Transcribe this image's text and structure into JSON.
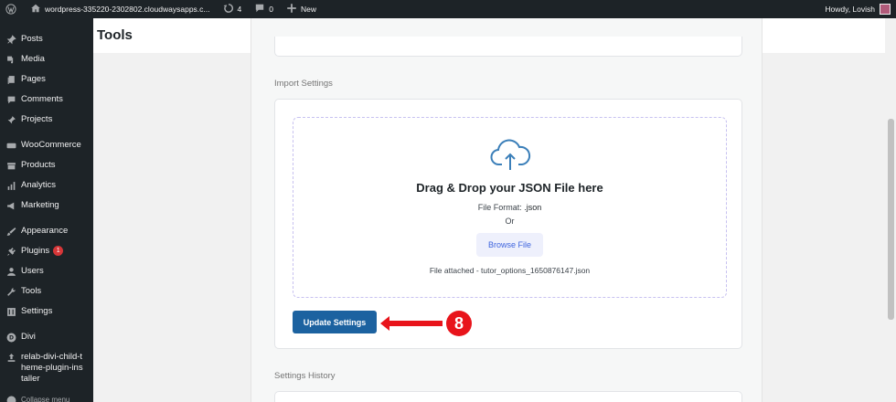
{
  "admin_bar": {
    "site_name": "wordpress-335220-2302802.cloudwaysapps.c...",
    "updates_count": "4",
    "comments_count": "0",
    "new_label": "New",
    "howdy": "Howdy, Lovish"
  },
  "sidebar": {
    "items": [
      {
        "label": "Posts",
        "icon": "pin-icon"
      },
      {
        "label": "Media",
        "icon": "media-icon"
      },
      {
        "label": "Pages",
        "icon": "pages-icon"
      },
      {
        "label": "Comments",
        "icon": "comment-icon"
      },
      {
        "label": "Projects",
        "icon": "pin-icon"
      },
      {
        "label": "WooCommerce",
        "icon": "woo-icon"
      },
      {
        "label": "Products",
        "icon": "products-icon"
      },
      {
        "label": "Analytics",
        "icon": "bar-chart-icon"
      },
      {
        "label": "Marketing",
        "icon": "megaphone-icon"
      },
      {
        "label": "Appearance",
        "icon": "brush-icon"
      },
      {
        "label": "Plugins",
        "icon": "plug-icon",
        "badge": "1"
      },
      {
        "label": "Users",
        "icon": "user-icon"
      },
      {
        "label": "Tools",
        "icon": "wrench-icon"
      },
      {
        "label": "Settings",
        "icon": "settings-icon"
      },
      {
        "label": "Divi",
        "icon": "divi-icon"
      },
      {
        "label": "relab-divi-child-theme-plugin-installer",
        "icon": "upload-icon"
      }
    ],
    "collapse_label": "Collapse menu"
  },
  "page": {
    "title": "Tools"
  },
  "import_settings": {
    "section_label": "Import Settings",
    "drop_title": "Drag & Drop your JSON File here",
    "format_label": "File Format:",
    "format_value": ".json",
    "or_label": "Or",
    "browse_label": "Browse File",
    "attached_text": "File attached - tutor_options_1650876147.json",
    "update_label": "Update Settings"
  },
  "annotation": {
    "step_number": "8",
    "color": "#e8141b"
  },
  "settings_history": {
    "section_label": "Settings History"
  },
  "colors": {
    "admin_dark": "#1d2327",
    "primary_button": "#1c62a0",
    "browse_text": "#3e64de",
    "dropzone_border": "#c7c1f0",
    "badge": "#d63638"
  }
}
